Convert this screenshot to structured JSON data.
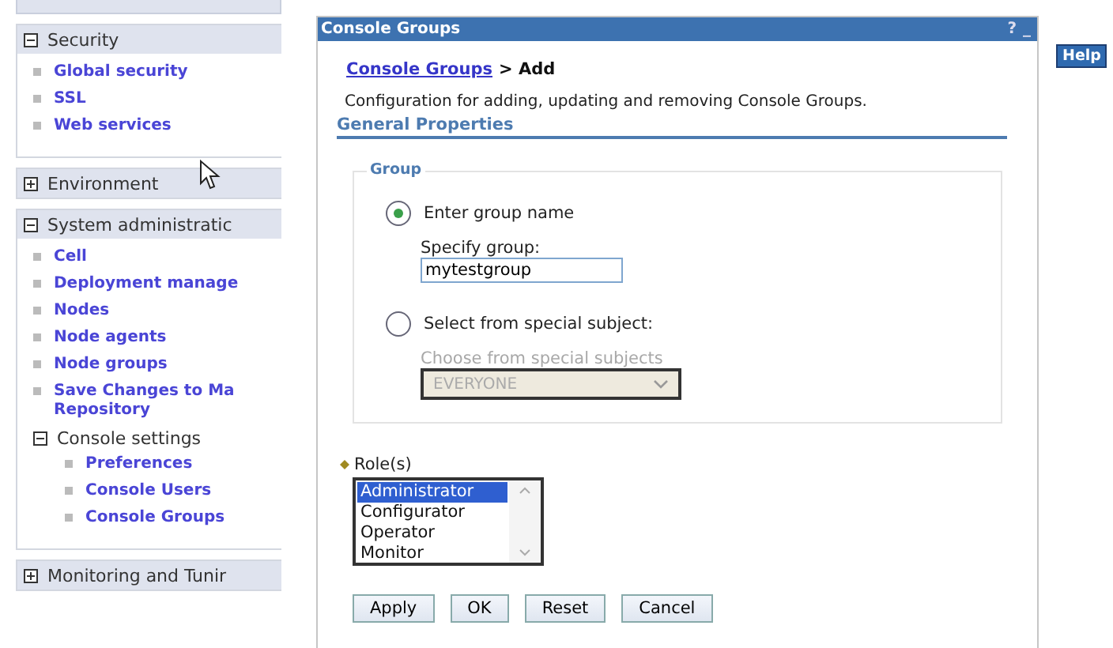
{
  "sidebar": {
    "sections": [
      {
        "label": "Security",
        "expanded": true,
        "items": [
          {
            "kind": "link",
            "label": "Global security"
          },
          {
            "kind": "link",
            "label": "SSL"
          },
          {
            "kind": "link",
            "label": "Web services"
          }
        ]
      },
      {
        "label": "Environment",
        "expanded": false
      },
      {
        "label": "System administratic",
        "expanded": true,
        "items": [
          {
            "kind": "link",
            "label": "Cell"
          },
          {
            "kind": "link",
            "label": "Deployment manage"
          },
          {
            "kind": "link",
            "label": "Nodes"
          },
          {
            "kind": "link",
            "label": "Node agents"
          },
          {
            "kind": "link",
            "label": "Node groups"
          },
          {
            "kind": "link",
            "label": "Save Changes to Ma\nRepository"
          },
          {
            "kind": "group",
            "label": "Console settings",
            "expanded": true,
            "children": [
              {
                "label": "Preferences"
              },
              {
                "label": "Console Users"
              },
              {
                "label": "Console Groups"
              }
            ]
          }
        ]
      },
      {
        "label": "Monitoring and Tunir",
        "expanded": false
      }
    ]
  },
  "panel": {
    "title": "Console Groups",
    "title_buttons": [
      "?",
      "_"
    ],
    "breadcrumb": {
      "link": "Console Groups",
      "current": "> Add"
    },
    "description": "Configuration for adding, updating and removing Console Groups.",
    "section_title": "General Properties",
    "group": {
      "legend": "Group",
      "options": [
        {
          "label": "Enter group name",
          "selected": true
        },
        {
          "label": "Select from special subject:",
          "selected": false
        }
      ],
      "name_field": {
        "label": "Specify group:",
        "value": "mytestgroup"
      },
      "special": {
        "label": "Choose from special subjects",
        "value": "EVERYONE",
        "disabled": true
      }
    },
    "roles": {
      "label": "Role(s)",
      "required": true,
      "options": [
        {
          "label": "Administrator",
          "selected": true
        },
        {
          "label": "Configurator",
          "selected": false
        },
        {
          "label": "Operator",
          "selected": false
        },
        {
          "label": "Monitor",
          "selected": false
        }
      ]
    },
    "buttons": [
      "Apply",
      "OK",
      "Reset",
      "Cancel"
    ]
  },
  "help": {
    "label": "Help"
  }
}
